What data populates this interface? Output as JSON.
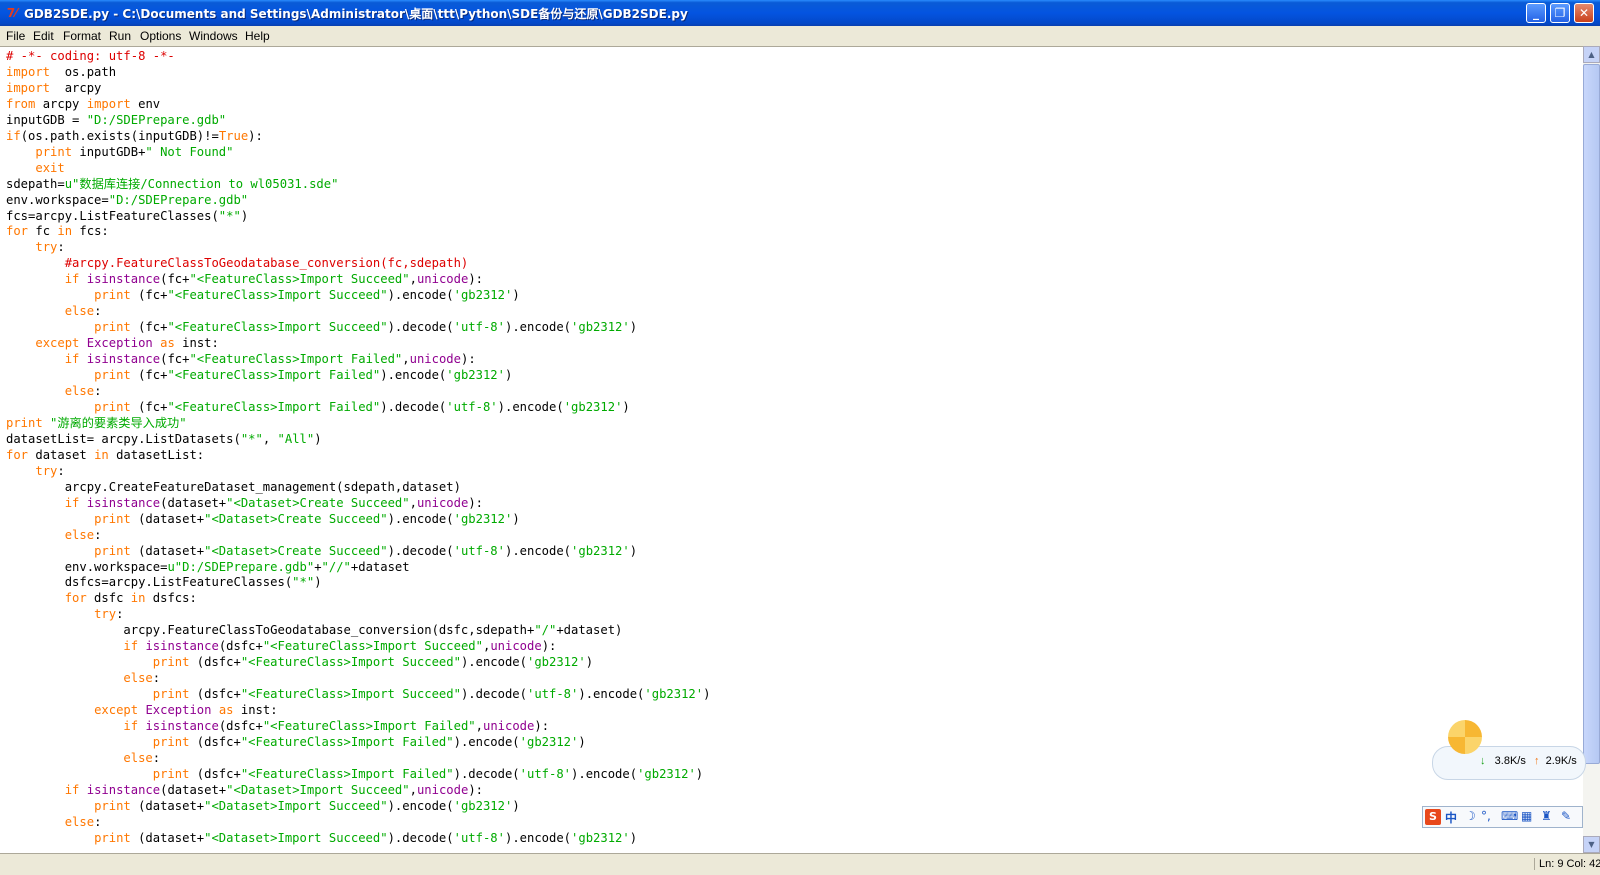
{
  "window": {
    "title": "GDB2SDE.py - C:\\Documents and Settings\\Administrator\\桌面\\ttt\\Python\\SDE备份与还原\\GDB2SDE.py",
    "icon": "python-idle-icon",
    "controls": [
      "minimize",
      "maximize",
      "close"
    ]
  },
  "menu": [
    "File",
    "Edit",
    "Format",
    "Run",
    "Options",
    "Windows",
    "Help"
  ],
  "code_lines": [
    [
      [
        "cm",
        "# -*- coding: utf-8 -*-"
      ]
    ],
    [
      [
        "kw",
        "import"
      ],
      [
        "",
        "  os.path"
      ]
    ],
    [
      [
        "kw",
        "import"
      ],
      [
        "",
        "  arcpy"
      ]
    ],
    [
      [
        "kw",
        "from"
      ],
      [
        "",
        " arcpy "
      ],
      [
        "kw",
        "import"
      ],
      [
        "",
        " env"
      ]
    ],
    [
      [
        "",
        "inputGDB = "
      ],
      [
        "st",
        "\"D:/SDEPrepare.gdb\""
      ]
    ],
    [
      [
        "kw",
        "if"
      ],
      [
        "",
        "(os.path.exists(inputGDB)!="
      ],
      [
        "kw",
        "True"
      ],
      [
        "",
        "):"
      ]
    ],
    [
      [
        "",
        "    "
      ],
      [
        "kw",
        "print"
      ],
      [
        "",
        " inputGDB+"
      ],
      [
        "st",
        "\" Not Found\""
      ]
    ],
    [
      [
        "",
        "    "
      ],
      [
        "kw",
        "exit"
      ]
    ],
    [
      [
        "",
        "sdepath="
      ],
      [
        "st",
        "u\"数据库连接/Connection to wl05031.sde\""
      ]
    ],
    [
      [
        "",
        "env.workspace="
      ],
      [
        "st",
        "\"D:/SDEPrepare.gdb\""
      ]
    ],
    [
      [
        "",
        "fcs=arcpy.ListFeatureClasses("
      ],
      [
        "st",
        "\"*\""
      ],
      [
        "",
        ")"
      ]
    ],
    [
      [
        "kw",
        "for"
      ],
      [
        "",
        " fc "
      ],
      [
        "kw",
        "in"
      ],
      [
        "",
        " fcs:"
      ]
    ],
    [
      [
        "",
        "    "
      ],
      [
        "kw",
        "try"
      ],
      [
        "",
        ":"
      ]
    ],
    [
      [
        "",
        "        "
      ],
      [
        "cm",
        "#arcpy.FeatureClassToGeodatabase_conversion(fc,sdepath)"
      ]
    ],
    [
      [
        "",
        "        "
      ],
      [
        "kw",
        "if"
      ],
      [
        "",
        " "
      ],
      [
        "bi",
        "isinstance"
      ],
      [
        "",
        "(fc+"
      ],
      [
        "st",
        "\"<FeatureClass>Import Succeed\""
      ],
      [
        "",
        ","
      ],
      [
        "bi",
        "unicode"
      ],
      [
        "",
        "):"
      ]
    ],
    [
      [
        "",
        "            "
      ],
      [
        "kw",
        "print"
      ],
      [
        "",
        " (fc+"
      ],
      [
        "st",
        "\"<FeatureClass>Import Succeed\""
      ],
      [
        "",
        ").encode("
      ],
      [
        "st",
        "'gb2312'"
      ],
      [
        "",
        ")"
      ]
    ],
    [
      [
        "",
        "        "
      ],
      [
        "kw",
        "else"
      ],
      [
        "",
        ":"
      ]
    ],
    [
      [
        "",
        "            "
      ],
      [
        "kw",
        "print"
      ],
      [
        "",
        " (fc+"
      ],
      [
        "st",
        "\"<FeatureClass>Import Succeed\""
      ],
      [
        "",
        ").decode("
      ],
      [
        "st",
        "'utf-8'"
      ],
      [
        "",
        ").encode("
      ],
      [
        "st",
        "'gb2312'"
      ],
      [
        "",
        ")"
      ]
    ],
    [
      [
        "",
        "    "
      ],
      [
        "kw",
        "except"
      ],
      [
        "",
        " "
      ],
      [
        "bi",
        "Exception"
      ],
      [
        "",
        " "
      ],
      [
        "kw",
        "as"
      ],
      [
        "",
        " inst:"
      ]
    ],
    [
      [
        "",
        "        "
      ],
      [
        "kw",
        "if"
      ],
      [
        "",
        " "
      ],
      [
        "bi",
        "isinstance"
      ],
      [
        "",
        "(fc+"
      ],
      [
        "st",
        "\"<FeatureClass>Import Failed\""
      ],
      [
        "",
        ","
      ],
      [
        "bi",
        "unicode"
      ],
      [
        "",
        "):"
      ]
    ],
    [
      [
        "",
        "            "
      ],
      [
        "kw",
        "print"
      ],
      [
        "",
        " (fc+"
      ],
      [
        "st",
        "\"<FeatureClass>Import Failed\""
      ],
      [
        "",
        ").encode("
      ],
      [
        "st",
        "'gb2312'"
      ],
      [
        "",
        ")"
      ]
    ],
    [
      [
        "",
        "        "
      ],
      [
        "kw",
        "else"
      ],
      [
        "",
        ":"
      ]
    ],
    [
      [
        "",
        "            "
      ],
      [
        "kw",
        "print"
      ],
      [
        "",
        " (fc+"
      ],
      [
        "st",
        "\"<FeatureClass>Import Failed\""
      ],
      [
        "",
        ").decode("
      ],
      [
        "st",
        "'utf-8'"
      ],
      [
        "",
        ").encode("
      ],
      [
        "st",
        "'gb2312'"
      ],
      [
        "",
        ")"
      ]
    ],
    [
      [
        "kw",
        "print"
      ],
      [
        "",
        " "
      ],
      [
        "st",
        "\"游离的要素类导入成功\""
      ]
    ],
    [
      [
        "",
        "datasetList= arcpy.ListDatasets("
      ],
      [
        "st",
        "\"*\""
      ],
      [
        "",
        ", "
      ],
      [
        "st",
        "\"All\""
      ],
      [
        "",
        ")"
      ]
    ],
    [
      [
        "kw",
        "for"
      ],
      [
        "",
        " dataset "
      ],
      [
        "kw",
        "in"
      ],
      [
        "",
        " datasetList:"
      ]
    ],
    [
      [
        "",
        "    "
      ],
      [
        "kw",
        "try"
      ],
      [
        "",
        ":"
      ]
    ],
    [
      [
        "",
        "        arcpy.CreateFeatureDataset_management(sdepath,dataset)"
      ]
    ],
    [
      [
        "",
        "        "
      ],
      [
        "kw",
        "if"
      ],
      [
        "",
        " "
      ],
      [
        "bi",
        "isinstance"
      ],
      [
        "",
        "(dataset+"
      ],
      [
        "st",
        "\"<Dataset>Create Succeed\""
      ],
      [
        "",
        ","
      ],
      [
        "bi",
        "unicode"
      ],
      [
        "",
        "):"
      ]
    ],
    [
      [
        "",
        "            "
      ],
      [
        "kw",
        "print"
      ],
      [
        "",
        " (dataset+"
      ],
      [
        "st",
        "\"<Dataset>Create Succeed\""
      ],
      [
        "",
        ").encode("
      ],
      [
        "st",
        "'gb2312'"
      ],
      [
        "",
        ")"
      ]
    ],
    [
      [
        "",
        "        "
      ],
      [
        "kw",
        "else"
      ],
      [
        "",
        ":"
      ]
    ],
    [
      [
        "",
        "            "
      ],
      [
        "kw",
        "print"
      ],
      [
        "",
        " (dataset+"
      ],
      [
        "st",
        "\"<Dataset>Create Succeed\""
      ],
      [
        "",
        ").decode("
      ],
      [
        "st",
        "'utf-8'"
      ],
      [
        "",
        ").encode("
      ],
      [
        "st",
        "'gb2312'"
      ],
      [
        "",
        ")"
      ]
    ],
    [
      [
        "",
        "        env.workspace="
      ],
      [
        "st",
        "u\"D:/SDEPrepare.gdb\""
      ],
      [
        "",
        "+"
      ],
      [
        "st",
        "\"//\""
      ],
      [
        "",
        "+dataset"
      ]
    ],
    [
      [
        "",
        "        dsfcs=arcpy.ListFeatureClasses("
      ],
      [
        "st",
        "\"*\""
      ],
      [
        "",
        ")"
      ]
    ],
    [
      [
        "",
        "        "
      ],
      [
        "kw",
        "for"
      ],
      [
        "",
        " dsfc "
      ],
      [
        "kw",
        "in"
      ],
      [
        "",
        " dsfcs:"
      ]
    ],
    [
      [
        "",
        "            "
      ],
      [
        "kw",
        "try"
      ],
      [
        "",
        ":"
      ]
    ],
    [
      [
        "",
        "                arcpy.FeatureClassToGeodatabase_conversion(dsfc,sdepath+"
      ],
      [
        "st",
        "\"/\""
      ],
      [
        "",
        "+dataset)"
      ]
    ],
    [
      [
        "",
        "                "
      ],
      [
        "kw",
        "if"
      ],
      [
        "",
        " "
      ],
      [
        "bi",
        "isinstance"
      ],
      [
        "",
        "(dsfc+"
      ],
      [
        "st",
        "\"<FeatureClass>Import Succeed\""
      ],
      [
        "",
        ","
      ],
      [
        "bi",
        "unicode"
      ],
      [
        "",
        "):"
      ]
    ],
    [
      [
        "",
        "                    "
      ],
      [
        "kw",
        "print"
      ],
      [
        "",
        " (dsfc+"
      ],
      [
        "st",
        "\"<FeatureClass>Import Succeed\""
      ],
      [
        "",
        ").encode("
      ],
      [
        "st",
        "'gb2312'"
      ],
      [
        "",
        ")"
      ]
    ],
    [
      [
        "",
        "                "
      ],
      [
        "kw",
        "else"
      ],
      [
        "",
        ":"
      ]
    ],
    [
      [
        "",
        "                    "
      ],
      [
        "kw",
        "print"
      ],
      [
        "",
        " (dsfc+"
      ],
      [
        "st",
        "\"<FeatureClass>Import Succeed\""
      ],
      [
        "",
        ").decode("
      ],
      [
        "st",
        "'utf-8'"
      ],
      [
        "",
        ").encode("
      ],
      [
        "st",
        "'gb2312'"
      ],
      [
        "",
        ")"
      ]
    ],
    [
      [
        "",
        "            "
      ],
      [
        "kw",
        "except"
      ],
      [
        "",
        " "
      ],
      [
        "bi",
        "Exception"
      ],
      [
        "",
        " "
      ],
      [
        "kw",
        "as"
      ],
      [
        "",
        " inst:"
      ]
    ],
    [
      [
        "",
        "                "
      ],
      [
        "kw",
        "if"
      ],
      [
        "",
        " "
      ],
      [
        "bi",
        "isinstance"
      ],
      [
        "",
        "(dsfc+"
      ],
      [
        "st",
        "\"<FeatureClass>Import Failed\""
      ],
      [
        "",
        ","
      ],
      [
        "bi",
        "unicode"
      ],
      [
        "",
        "):"
      ]
    ],
    [
      [
        "",
        "                    "
      ],
      [
        "kw",
        "print"
      ],
      [
        "",
        " (dsfc+"
      ],
      [
        "st",
        "\"<FeatureClass>Import Failed\""
      ],
      [
        "",
        ").encode("
      ],
      [
        "st",
        "'gb2312'"
      ],
      [
        "",
        ")"
      ]
    ],
    [
      [
        "",
        "                "
      ],
      [
        "kw",
        "else"
      ],
      [
        "",
        ":"
      ]
    ],
    [
      [
        "",
        "                    "
      ],
      [
        "kw",
        "print"
      ],
      [
        "",
        " (dsfc+"
      ],
      [
        "st",
        "\"<FeatureClass>Import Failed\""
      ],
      [
        "",
        ").decode("
      ],
      [
        "st",
        "'utf-8'"
      ],
      [
        "",
        ").encode("
      ],
      [
        "st",
        "'gb2312'"
      ],
      [
        "",
        ")"
      ]
    ],
    [
      [
        "",
        "        "
      ],
      [
        "kw",
        "if"
      ],
      [
        "",
        " "
      ],
      [
        "bi",
        "isinstance"
      ],
      [
        "",
        "(dataset+"
      ],
      [
        "st",
        "\"<Dataset>Import Succeed\""
      ],
      [
        "",
        ","
      ],
      [
        "bi",
        "unicode"
      ],
      [
        "",
        "):"
      ]
    ],
    [
      [
        "",
        "            "
      ],
      [
        "kw",
        "print"
      ],
      [
        "",
        " (dataset+"
      ],
      [
        "st",
        "\"<Dataset>Import Succeed\""
      ],
      [
        "",
        ").encode("
      ],
      [
        "st",
        "'gb2312'"
      ],
      [
        "",
        ")"
      ]
    ],
    [
      [
        "",
        "        "
      ],
      [
        "kw",
        "else"
      ],
      [
        "",
        ":"
      ]
    ],
    [
      [
        "",
        "            "
      ],
      [
        "kw",
        "print"
      ],
      [
        "",
        " (dataset+"
      ],
      [
        "st",
        "\"<Dataset>Import Succeed\""
      ],
      [
        "",
        ").decode("
      ],
      [
        "st",
        "'utf-8'"
      ],
      [
        "",
        ").encode("
      ],
      [
        "st",
        "'gb2312'"
      ],
      [
        "",
        ")"
      ]
    ]
  ],
  "syntax_colors": {
    "kw": "#ff7700",
    "st": "#00aa00",
    "cm": "#dd0000",
    "bi": "#900090"
  },
  "network_monitor": {
    "download": "3.8K/s",
    "upload": "2.9K/s"
  },
  "ime_toolbar": {
    "logo": "S",
    "mode": "中"
  },
  "status": {
    "position": "Ln: 9 Col: 42"
  }
}
